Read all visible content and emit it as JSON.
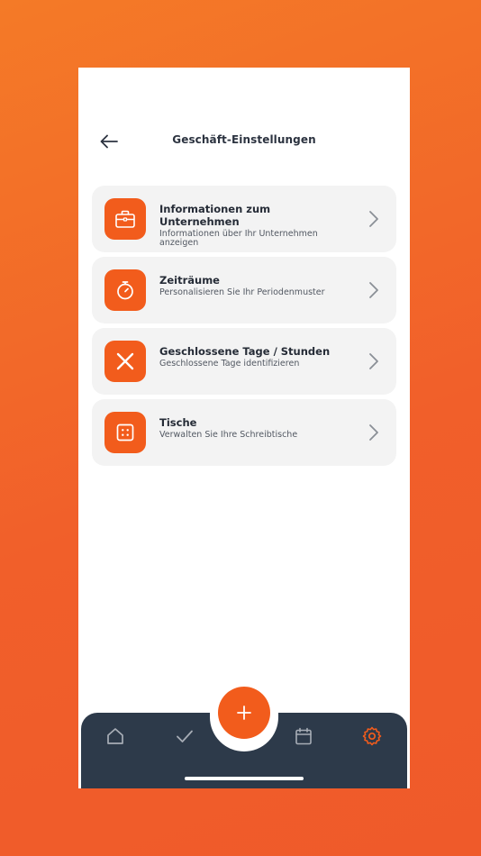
{
  "header": {
    "title": "Geschäft-Einstellungen"
  },
  "menu": [
    {
      "title": "Informationen zum Unternehmen",
      "subtitle": "Informationen über Ihr Unternehmen anzeigen",
      "icon": "briefcase-icon"
    },
    {
      "title": "Zeiträume",
      "subtitle": "Personalisieren Sie Ihr Periodenmuster",
      "icon": "stopwatch-icon"
    },
    {
      "title": "Geschlossene Tage / Stunden",
      "subtitle": "Geschlossene Tage identifizieren",
      "icon": "close-x-icon"
    },
    {
      "title": "Tische",
      "subtitle": "Verwalten Sie Ihre Schreibtische",
      "icon": "table-grid-icon"
    }
  ],
  "nav": {
    "items": [
      "home-icon",
      "check-icon",
      "plus-icon",
      "calendar-icon",
      "gear-icon"
    ],
    "active": "gear-icon"
  },
  "colors": {
    "accent": "#f25c1c",
    "navbar": "#2d3a4a",
    "card": "#f3f3f3",
    "background": "#f15f2a"
  }
}
